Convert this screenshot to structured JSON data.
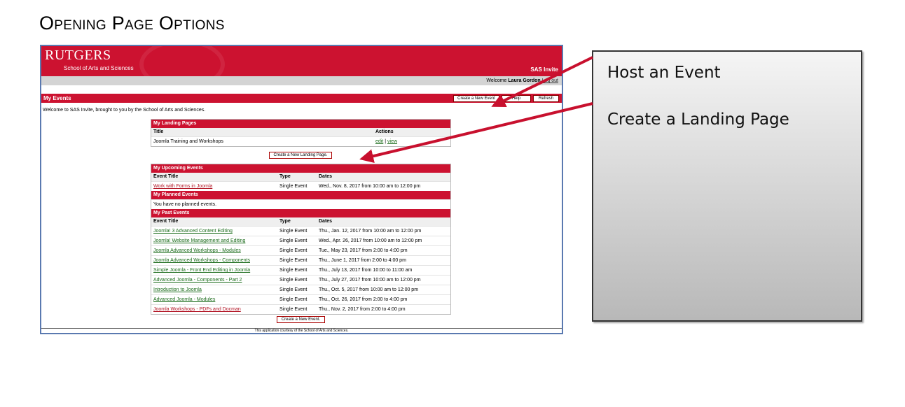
{
  "document": {
    "heading": "Opening Page Options"
  },
  "screenshot": {
    "logo": "RUTGERS",
    "school": "School of Arts and Sciences",
    "app_name": "SAS Invite",
    "welcome": {
      "prefix": "Welcome ",
      "user": "Laura Gordon",
      "logout": "Log out"
    },
    "page_title": "My Events",
    "buttons": {
      "create_event": "Create a New Event",
      "help": "Help",
      "refresh": "Refresh",
      "create_landing": "Create a New Landing Page.",
      "create_event_bottom": "Create a New Event."
    },
    "intro": "Welcome to SAS Invite, brought to you by the School of Arts and Sciences.",
    "landing_pages": {
      "header": "My Landing Pages",
      "columns": [
        "Title",
        "Actions"
      ],
      "rows": [
        {
          "title": "Joomla Training and Workshops",
          "edit": "edit",
          "sep": " | ",
          "view": "view"
        }
      ]
    },
    "upcoming": {
      "header": "My Upcoming Events",
      "columns": [
        "Event Title",
        "Type",
        "Dates"
      ],
      "rows": [
        {
          "title": "Work with Forms in Joomla",
          "type": "Single Event",
          "dates": "Wed., Nov. 8, 2017 from 10:00 am to 12:00 pm"
        }
      ]
    },
    "planned": {
      "header": "My Planned Events",
      "empty": "You have no planned events."
    },
    "past": {
      "header": "My Past Events",
      "columns": [
        "Event Title",
        "Type",
        "Dates"
      ],
      "rows": [
        {
          "title": "Joomla! 3 Advanced Content Editing",
          "type": "Single Event",
          "dates": "Thu., Jan. 12, 2017 from 10:00 am to 12:00 pm",
          "color": "green"
        },
        {
          "title": "Joomla! Website Management and Editing",
          "type": "Single Event",
          "dates": "Wed., Apr. 26, 2017 from 10:00 am to 12:00 pm",
          "color": "green"
        },
        {
          "title": "Joomla Advanced Workshops - Modules",
          "type": "Single Event",
          "dates": "Tue., May 23, 2017 from 2:00 to 4:00 pm",
          "color": "green"
        },
        {
          "title": "Joomla Advanced Workshops - Components",
          "type": "Single Event",
          "dates": "Thu., June 1, 2017 from 2:00 to 4:00 pm",
          "color": "green"
        },
        {
          "title": "Simple Joomla - Front End Editing in Joomla",
          "type": "Single Event",
          "dates": "Thu., July 13, 2017 from 10:00 to 11:00 am",
          "color": "green"
        },
        {
          "title": "Advanced Joomla - Components - Part 2",
          "type": "Single Event",
          "dates": "Thu., July 27, 2017 from 10:00 am to 12:00 pm",
          "color": "green"
        },
        {
          "title": "Introduction to Joomla",
          "type": "Single Event",
          "dates": "Thu., Oct. 5, 2017 from 10:00 am to 12:00 pm",
          "color": "green"
        },
        {
          "title": "Advanced Joomla - Modules",
          "type": "Single Event",
          "dates": "Thu., Oct. 26, 2017 from 2:00 to 4:00 pm",
          "color": "green"
        },
        {
          "title": "Joomla Workshops - PDFs and Docman",
          "type": "Single Event",
          "dates": "Thu., Nov. 2, 2017 from 2:00 to 4:00 pm",
          "color": "red"
        }
      ]
    },
    "footer": "This application courtesy of the School of Arts and Sciences."
  },
  "callout": {
    "line1": "Host an Event",
    "line2": "Create a Landing Page"
  },
  "colors": {
    "brand": "#cc1230",
    "arrow": "#c8102e"
  }
}
